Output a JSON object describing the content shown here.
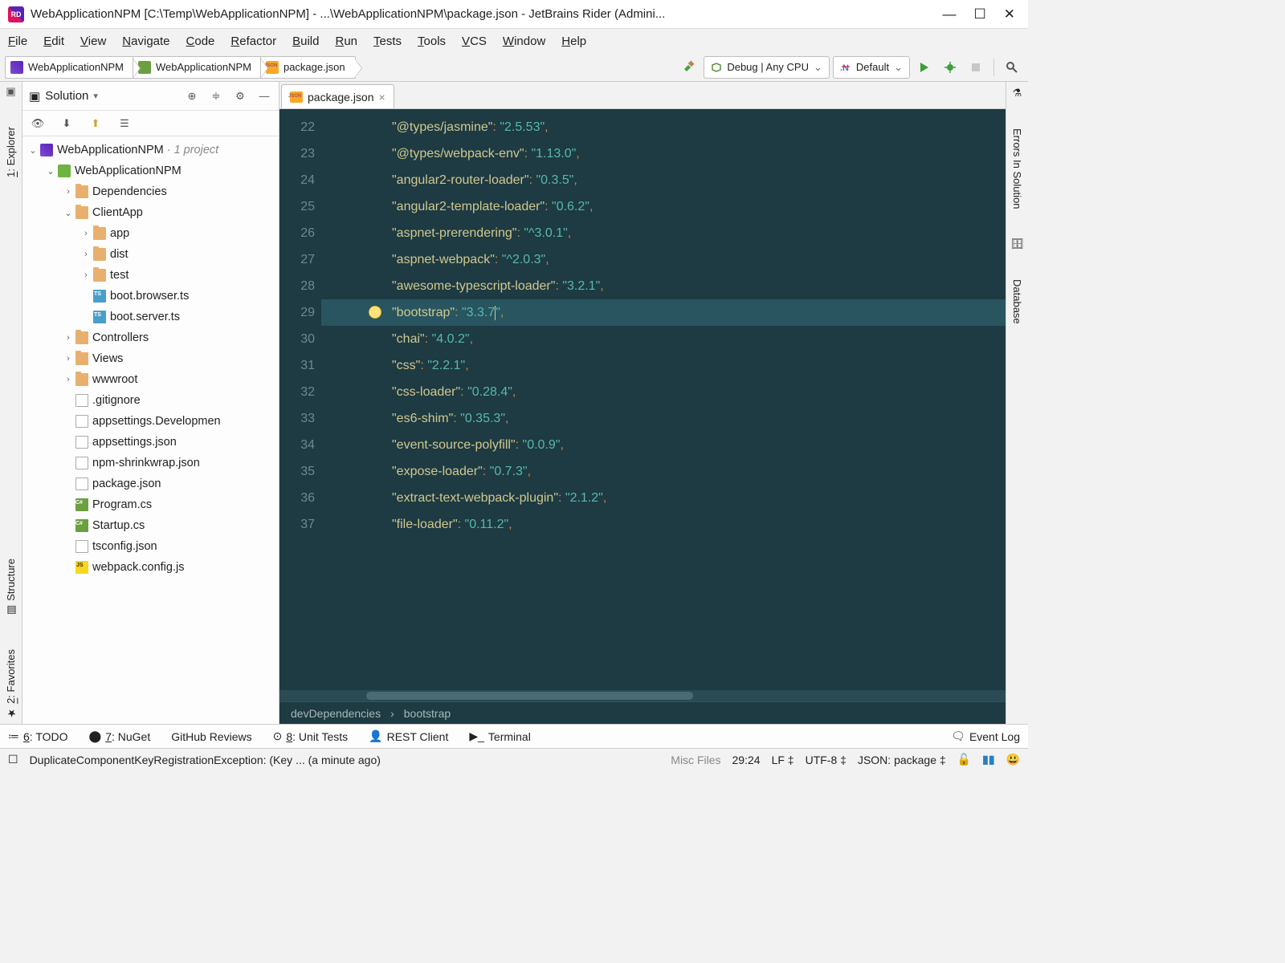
{
  "window": {
    "title": "WebApplicationNPM [C:\\Temp\\WebApplicationNPM] - ...\\WebApplicationNPM\\package.json - JetBrains Rider (Admini..."
  },
  "menu": [
    "File",
    "Edit",
    "View",
    "Navigate",
    "Code",
    "Refactor",
    "Build",
    "Run",
    "Tests",
    "Tools",
    "VCS",
    "Window",
    "Help"
  ],
  "breadcrumbs": [
    {
      "icon": "sln",
      "label": "WebApplicationNPM"
    },
    {
      "icon": "cs",
      "label": "WebApplicationNPM"
    },
    {
      "icon": "json",
      "label": "package.json"
    }
  ],
  "runconfig": {
    "label": "Debug | Any CPU"
  },
  "target": {
    "label": "Default"
  },
  "solution": {
    "header": "Solution",
    "root": {
      "label": "WebApplicationNPM",
      "suffix": "· 1 project"
    },
    "project": "WebApplicationNPM",
    "nodes": [
      {
        "ind": 2,
        "arr": "›",
        "icon": "fold",
        "label": "Dependencies"
      },
      {
        "ind": 2,
        "arr": "⌄",
        "icon": "fold",
        "label": "ClientApp"
      },
      {
        "ind": 3,
        "arr": "›",
        "icon": "fold",
        "label": "app"
      },
      {
        "ind": 3,
        "arr": "›",
        "icon": "fold",
        "label": "dist"
      },
      {
        "ind": 3,
        "arr": "›",
        "icon": "fold",
        "label": "test"
      },
      {
        "ind": 3,
        "arr": "",
        "icon": "ts",
        "label": "boot.browser.ts"
      },
      {
        "ind": 3,
        "arr": "",
        "icon": "ts",
        "label": "boot.server.ts"
      },
      {
        "ind": 2,
        "arr": "›",
        "icon": "fold",
        "label": "Controllers"
      },
      {
        "ind": 2,
        "arr": "›",
        "icon": "fold",
        "label": "Views"
      },
      {
        "ind": 2,
        "arr": "›",
        "icon": "fold",
        "label": "wwwroot"
      },
      {
        "ind": 2,
        "arr": "",
        "icon": "file",
        "label": ".gitignore"
      },
      {
        "ind": 2,
        "arr": "",
        "icon": "json",
        "label": "appsettings.Developmen"
      },
      {
        "ind": 2,
        "arr": "",
        "icon": "json",
        "label": "appsettings.json"
      },
      {
        "ind": 2,
        "arr": "",
        "icon": "json",
        "label": "npm-shrinkwrap.json"
      },
      {
        "ind": 2,
        "arr": "",
        "icon": "json",
        "label": "package.json"
      },
      {
        "ind": 2,
        "arr": "",
        "icon": "cs",
        "label": "Program.cs"
      },
      {
        "ind": 2,
        "arr": "",
        "icon": "cs",
        "label": "Startup.cs"
      },
      {
        "ind": 2,
        "arr": "",
        "icon": "json",
        "label": "tsconfig.json"
      },
      {
        "ind": 2,
        "arr": "",
        "icon": "js",
        "label": "webpack.config.js"
      }
    ]
  },
  "tab": {
    "label": "package.json"
  },
  "code": {
    "start": 22,
    "hl": 29,
    "lines": [
      {
        "k": "@types/jasmine",
        "v": "2.5.53"
      },
      {
        "k": "@types/webpack-env",
        "v": "1.13.0"
      },
      {
        "k": "angular2-router-loader",
        "v": "0.3.5"
      },
      {
        "k": "angular2-template-loader",
        "v": "0.6.2"
      },
      {
        "k": "aspnet-prerendering",
        "v": "^3.0.1"
      },
      {
        "k": "aspnet-webpack",
        "v": "^2.0.3"
      },
      {
        "k": "awesome-typescript-loader",
        "v": "3.2.1"
      },
      {
        "k": "bootstrap",
        "v": "3.3.7"
      },
      {
        "k": "chai",
        "v": "4.0.2"
      },
      {
        "k": "css",
        "v": "2.2.1"
      },
      {
        "k": "css-loader",
        "v": "0.28.4"
      },
      {
        "k": "es6-shim",
        "v": "0.35.3"
      },
      {
        "k": "event-source-polyfill",
        "v": "0.0.9"
      },
      {
        "k": "expose-loader",
        "v": "0.7.3"
      },
      {
        "k": "extract-text-webpack-plugin",
        "v": "2.1.2"
      },
      {
        "k": "file-loader",
        "v": "0.11.2"
      }
    ]
  },
  "editorCrumbs": [
    "devDependencies",
    "bootstrap"
  ],
  "leftTools": [
    "1: Explorer",
    "Structure",
    "2: Favorites"
  ],
  "rightTools": [
    "Errors In Solution",
    "Database"
  ],
  "bottom": [
    {
      "icon": "≔",
      "label": "6: TODO"
    },
    {
      "icon": "⬤",
      "label": "7: NuGet"
    },
    {
      "icon": "",
      "label": "GitHub Reviews"
    },
    {
      "icon": "⊙",
      "label": "8: Unit Tests"
    },
    {
      "icon": "👤",
      "label": "REST Client"
    },
    {
      "icon": "▶_",
      "label": "Terminal"
    }
  ],
  "eventlog": "Event Log",
  "status": {
    "msg": "DuplicateComponentKeyRegistrationException:  (Key ... (a minute ago)",
    "context": "Misc Files",
    "pos": "29:24",
    "le": "LF",
    "enc": "UTF-8",
    "schema": "JSON: package"
  }
}
